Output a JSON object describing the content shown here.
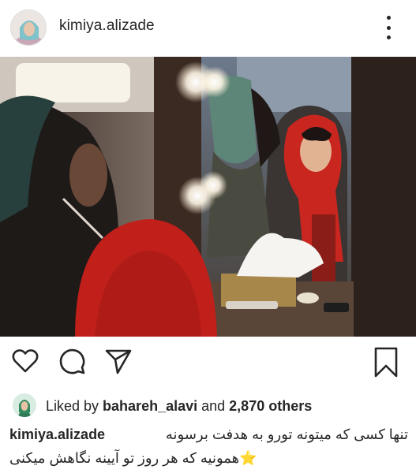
{
  "post": {
    "username": "kimiya.alizade",
    "more_icon": "more-vertical-icon"
  },
  "actions": {
    "like_icon": "heart-icon",
    "comment_icon": "comment-icon",
    "share_icon": "send-icon",
    "save_icon": "bookmark-icon"
  },
  "likes": {
    "prefix": "Liked by ",
    "liker": "bahareh_alavi",
    "joiner": " and ",
    "others": "2,870 others"
  },
  "caption": {
    "username": "kimiya.alizade",
    "line1": "تنها کسی که میتونه تورو به هدفت برسونه",
    "line2": "همونیه که هر روز تو آیینه نگاهش میکنی",
    "emoji": "⭐"
  },
  "colors": {
    "text": "#262626",
    "background": "#ffffff",
    "scarf_red": "#c8261f"
  }
}
